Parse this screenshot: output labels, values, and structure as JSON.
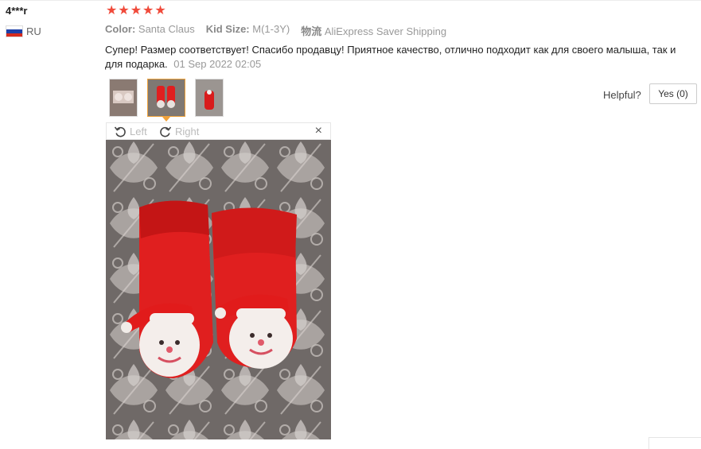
{
  "review": {
    "user": "4***r",
    "country": "RU",
    "rating": 5,
    "attributes": [
      {
        "key": "Color:",
        "value": "Santa Claus"
      },
      {
        "key": "Kid Size:",
        "value": "M(1-3Y)"
      },
      {
        "key": "物流",
        "value": "AliExpress Saver Shipping"
      }
    ],
    "text": "Супер! Размер соответствует! Спасибо продавцу! Приятное качество, отлично подходит как для своего малыша, так и для подарка.",
    "date": "01 Sep 2022 02:05"
  },
  "helpful": {
    "label": "Helpful?",
    "yes_label": "Yes (0)"
  },
  "viewer": {
    "rotate_left": "Left",
    "rotate_right": "Right",
    "close": "×"
  },
  "colors": {
    "star": "#f04a3a",
    "active_thumb": "#f0a23a",
    "sock_red": "#e01f1f"
  }
}
